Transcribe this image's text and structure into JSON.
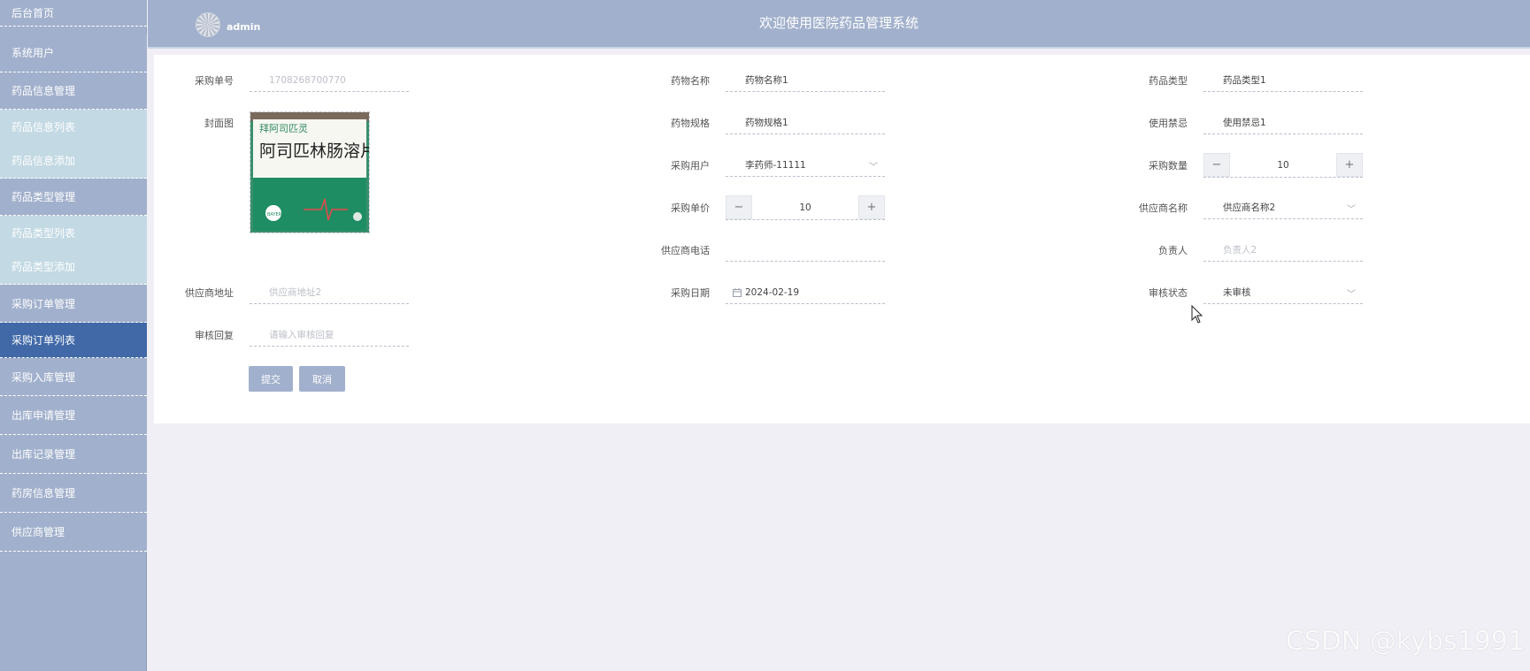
{
  "sidebar": {
    "items": [
      {
        "label": "后台首页"
      },
      {
        "label": "系统用户"
      },
      {
        "label": "药品信息管理"
      },
      {
        "label": "药品信息列表"
      },
      {
        "label": "药品信息添加"
      },
      {
        "label": "药品类型管理"
      },
      {
        "label": "药品类型列表"
      },
      {
        "label": "药品类型添加"
      },
      {
        "label": "采购订单管理"
      },
      {
        "label": "采购订单列表"
      },
      {
        "label": "采购入库管理"
      },
      {
        "label": "出库申请管理"
      },
      {
        "label": "出库记录管理"
      },
      {
        "label": "药房信息管理"
      },
      {
        "label": "供应商管理"
      }
    ]
  },
  "header": {
    "username": "admin",
    "title": "欢迎使用医院药品管理系统"
  },
  "form": {
    "order_no": {
      "label": "采购单号",
      "value": "1708268700770"
    },
    "drug_name": {
      "label": "药物名称",
      "value": "药物名称1"
    },
    "drug_type": {
      "label": "药品类型",
      "value": "药品类型1"
    },
    "cover": {
      "label": "封面图",
      "image_text": "阿司匹林肠溶片",
      "image_top_text": "拜阿司匹灵",
      "image_brand": "BAYER"
    },
    "drug_spec": {
      "label": "药物规格",
      "value": "药物规格1"
    },
    "taboo": {
      "label": "使用禁忌",
      "value": "使用禁忌1"
    },
    "purchase_user": {
      "label": "采购用户",
      "value": "李药师-11111"
    },
    "quantity": {
      "label": "采购数量",
      "value": "10",
      "minus": "−",
      "plus": "+"
    },
    "unit_price": {
      "label": "采购单价",
      "value": "10",
      "minus": "−",
      "plus": "+"
    },
    "supplier_name": {
      "label": "供应商名称",
      "value": "供应商名称2"
    },
    "supplier_phone": {
      "label": "供应商电话",
      "value": ""
    },
    "person_in_charge": {
      "label": "负责人",
      "placeholder": "负责人2"
    },
    "supplier_address": {
      "label": "供应商地址",
      "placeholder": "供应商地址2"
    },
    "purchase_date": {
      "label": "采购日期",
      "value": "2024-02-19"
    },
    "review_status": {
      "label": "审核状态",
      "value": "未审核"
    },
    "review_reply": {
      "label": "审核回复",
      "placeholder": "请输入审核回复"
    },
    "submit_label": "提交",
    "cancel_label": "取消"
  },
  "watermark": "CSDN @kybs1991",
  "colors": {
    "sidebar_bg": "#a1b0cc",
    "sidebar_sub_bg": "#c3d9e3",
    "sidebar_active_bg": "#4169a7",
    "header_bg": "#a1b0cc",
    "page_bg": "#f0eff5"
  }
}
